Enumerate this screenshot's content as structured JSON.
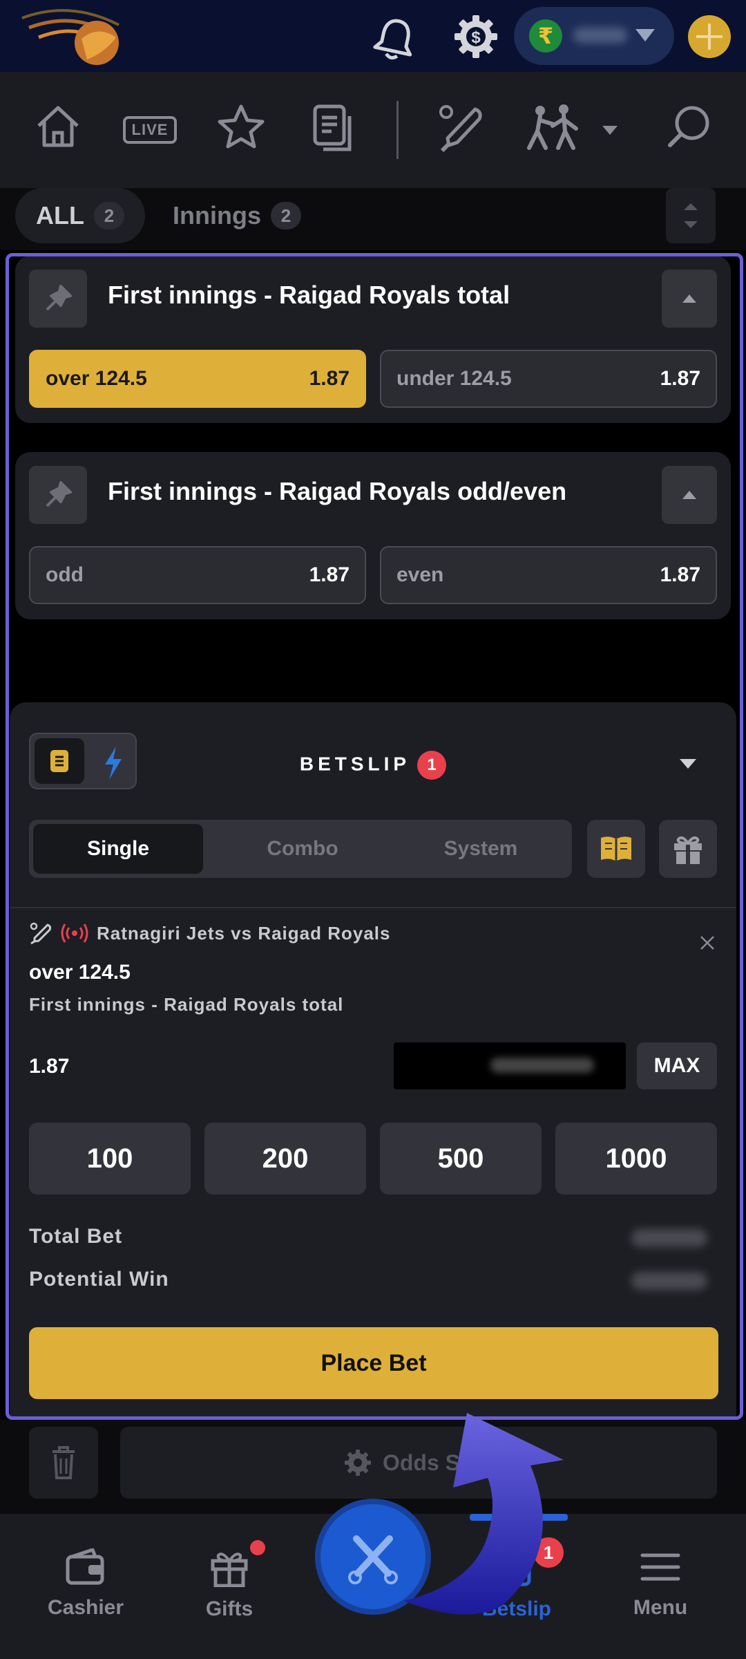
{
  "header": {
    "currency_symbol": "₹"
  },
  "nav": {
    "live_label": "LIVE"
  },
  "filters": [
    {
      "label": "ALL",
      "count": "2"
    },
    {
      "label": "Innings",
      "count": "2"
    }
  ],
  "markets": [
    {
      "title": "First innings - Raigad Royals total",
      "options": [
        {
          "label": "over 124.5",
          "odds": "1.87",
          "selected": true
        },
        {
          "label": "under 124.5",
          "odds": "1.87",
          "selected": false
        }
      ]
    },
    {
      "title": "First innings - Raigad Royals odd/even",
      "options": [
        {
          "label": "odd",
          "odds": "1.87",
          "selected": false
        },
        {
          "label": "even",
          "odds": "1.87",
          "selected": false
        }
      ]
    }
  ],
  "betslip": {
    "title": "BETSLIP",
    "count": "1",
    "tabs": [
      "Single",
      "Combo",
      "System"
    ],
    "active_tab": "Single",
    "bet": {
      "match": "Ratnagiri Jets vs Raigad Royals",
      "selection": "over 124.5",
      "market": "First innings - Raigad Royals total",
      "odds": "1.87"
    },
    "max_label": "MAX",
    "quick_stakes": [
      "100",
      "200",
      "500",
      "1000"
    ],
    "total_bet_label": "Total Bet",
    "potential_win_label": "Potential Win",
    "place_bet_label": "Place Bet"
  },
  "actions": {
    "odds_settings_label": "Odds Setti"
  },
  "bottom_nav": {
    "items": [
      {
        "label": "Cashier"
      },
      {
        "label": "Gifts"
      },
      {
        "label": "Betslip",
        "badge": "1"
      },
      {
        "label": "Menu"
      }
    ]
  },
  "colors": {
    "accent_gold": "#deb03a",
    "active_blue": "#2a63d8",
    "badge_red": "#e8414b",
    "frame_purple": "#6a5fd6"
  }
}
